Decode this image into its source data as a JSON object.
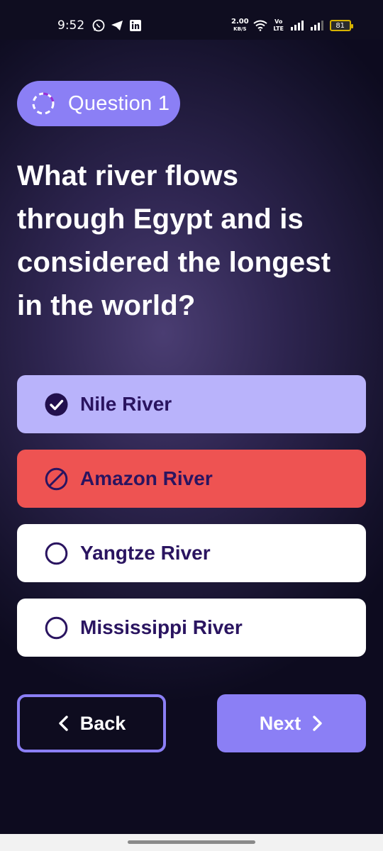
{
  "status_bar": {
    "time": "9:52",
    "speed_value": "2.00",
    "speed_unit": "KB/S",
    "network_label": "Vo LTE",
    "battery_level": "81",
    "left_icons": [
      "whatsapp-icon",
      "telegram-icon",
      "linkedin-icon"
    ],
    "right_icons": [
      "wifi-icon",
      "signal-icon",
      "signal-icon"
    ]
  },
  "question": {
    "chip_label": "Question 1",
    "text": "What river flows through Egypt and is considered the longest in the world?"
  },
  "options": [
    {
      "label": "Nile River",
      "state": "correct",
      "icon": "check-circle-icon",
      "color": "#b9b3fb"
    },
    {
      "label": "Amazon River",
      "state": "wrong",
      "icon": "block-icon",
      "color": "#ee5352"
    },
    {
      "label": "Yangtze River",
      "state": "unselected",
      "icon": "radio-empty-icon",
      "color": "#ffffff"
    },
    {
      "label": "Mississippi River",
      "state": "unselected",
      "icon": "radio-empty-icon",
      "color": "#ffffff"
    }
  ],
  "navigation": {
    "back_label": "Back",
    "next_label": "Next"
  },
  "colors": {
    "accent": "#8b7ff5",
    "option_text": "#2a1460"
  }
}
